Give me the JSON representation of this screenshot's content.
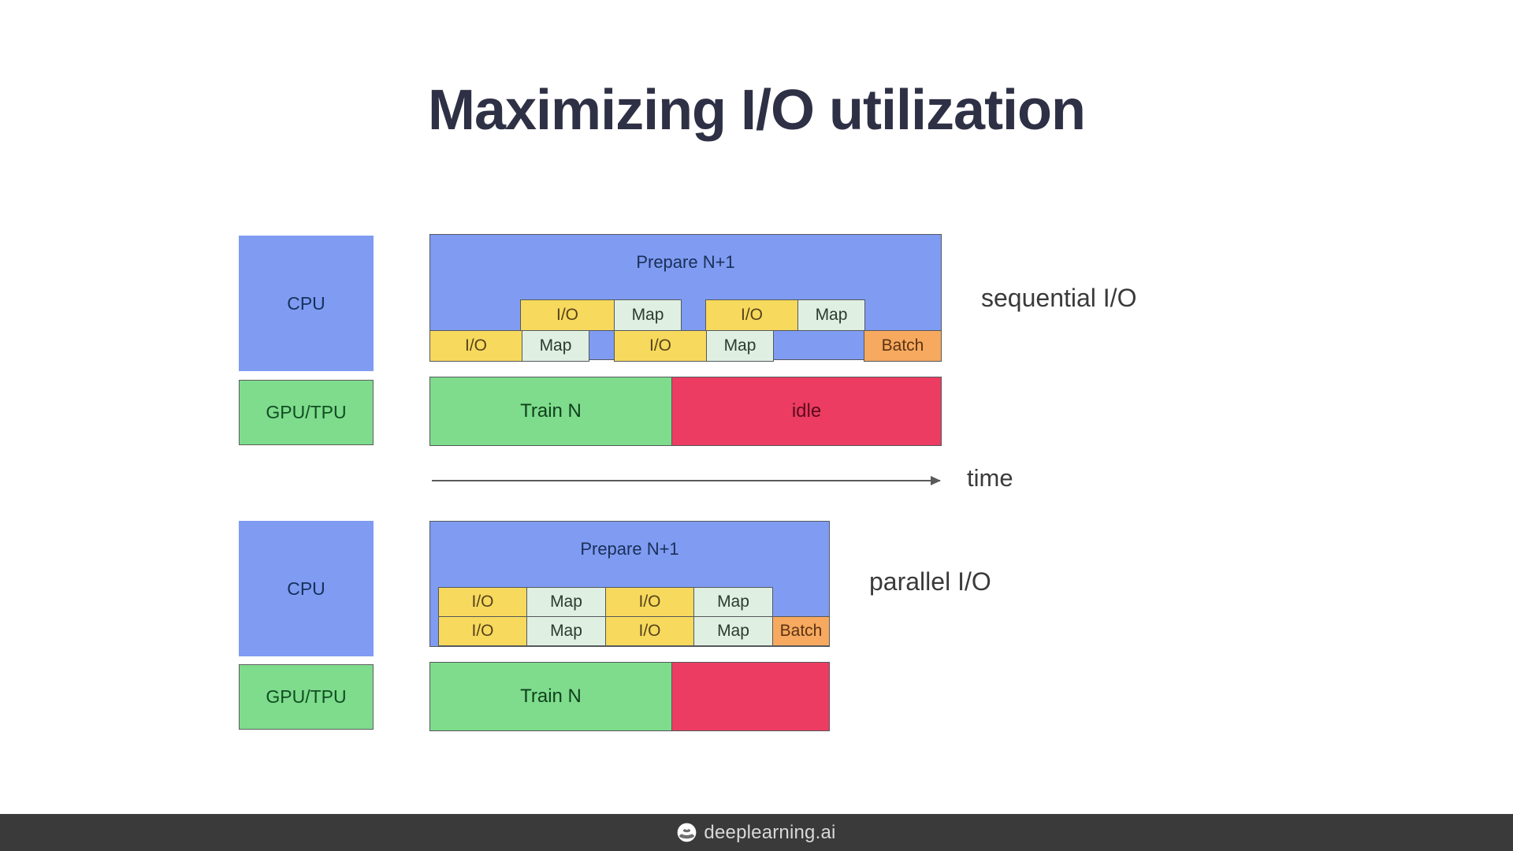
{
  "slide": {
    "title": "Maximizing I/O utilization"
  },
  "diagram": {
    "time_axis_label": "time",
    "sections": [
      {
        "id": "sequential",
        "annotation": "sequential I/O",
        "device_rows": [
          {
            "id": "cpu",
            "label": "CPU"
          },
          {
            "id": "gpu_tpu",
            "label": "GPU/TPU"
          }
        ],
        "cpu": {
          "container_label": "Prepare N+1",
          "upper_track": [
            {
              "label": "I/O",
              "kind": "io"
            },
            {
              "label": "Map",
              "kind": "map"
            },
            {
              "label": "I/O",
              "kind": "io"
            },
            {
              "label": "Map",
              "kind": "map"
            }
          ],
          "lower_track": [
            {
              "label": "I/O",
              "kind": "io"
            },
            {
              "label": "Map",
              "kind": "map"
            },
            {
              "label": "I/O",
              "kind": "io"
            },
            {
              "label": "Map",
              "kind": "map"
            },
            {
              "label": "Batch",
              "kind": "batch"
            }
          ]
        },
        "accelerator": [
          {
            "label": "Train N",
            "kind": "train"
          },
          {
            "label": "idle",
            "kind": "idle"
          }
        ]
      },
      {
        "id": "parallel",
        "annotation": "parallel I/O",
        "device_rows": [
          {
            "id": "cpu",
            "label": "CPU"
          },
          {
            "id": "gpu_tpu",
            "label": "GPU/TPU"
          }
        ],
        "cpu": {
          "container_label": "Prepare N+1",
          "upper_track": [
            {
              "label": "I/O",
              "kind": "io"
            },
            {
              "label": "Map",
              "kind": "map"
            },
            {
              "label": "I/O",
              "kind": "io"
            },
            {
              "label": "Map",
              "kind": "map"
            }
          ],
          "lower_track": [
            {
              "label": "I/O",
              "kind": "io"
            },
            {
              "label": "Map",
              "kind": "map"
            },
            {
              "label": "I/O",
              "kind": "io"
            },
            {
              "label": "Map",
              "kind": "map"
            },
            {
              "label": "Batch",
              "kind": "batch"
            }
          ]
        },
        "accelerator": [
          {
            "label": "Train N",
            "kind": "train"
          },
          {
            "label": "",
            "kind": "idle"
          }
        ]
      }
    ]
  },
  "footer": {
    "brand": "deeplearning.ai",
    "logo_icon": "deeplearning-rings-icon"
  },
  "colors": {
    "title": "#2e3045",
    "cpu": "#7f9cf2",
    "gpu_tpu": "#7edc8c",
    "io": "#f7d95e",
    "map": "#dff0e2",
    "batch": "#f6a95f",
    "train": "#7edc8c",
    "idle": "#ec3c62",
    "footer_bar": "#3a3a3a",
    "background": "#ffffff"
  }
}
